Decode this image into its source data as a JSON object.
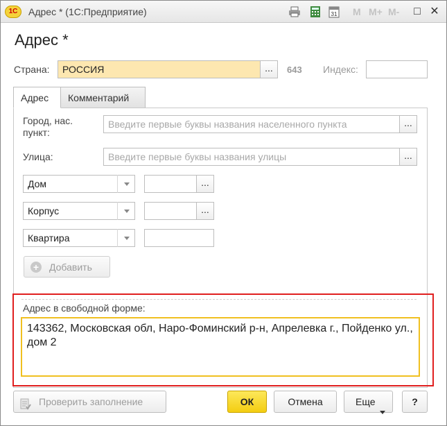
{
  "window": {
    "title": "Адрес * (1С:Предприятие)",
    "logo_text": "1С",
    "m_buttons": [
      "M",
      "M+",
      "M-"
    ],
    "minimize": "□",
    "close": "✕"
  },
  "form": {
    "title": "Адрес *"
  },
  "country": {
    "label": "Страна:",
    "value": "РОССИЯ",
    "code": "643",
    "index_label": "Индекс:",
    "index_value": "",
    "select_label": "..."
  },
  "tabs": [
    {
      "label": "Адрес",
      "active": true
    },
    {
      "label": "Комментарий",
      "active": false
    }
  ],
  "address": {
    "city_label_line1": "Город, нас.",
    "city_label_line2": "пункт:",
    "city_placeholder": "Введите первые буквы названия населенного пункта",
    "street_label": "Улица:",
    "street_placeholder": "Введите первые буквы названия улицы",
    "ellipsis": "...",
    "rows": [
      {
        "type": "Дом",
        "value": ""
      },
      {
        "type": "Корпус",
        "value": ""
      },
      {
        "type": "Квартира",
        "value": ""
      }
    ],
    "add_button": "Добавить"
  },
  "free_form": {
    "label": "Адрес в свободной форме:",
    "value": "143362, Московская обл, Наро-Фоминский р-н, Апрелевка г., Пойденко ул., дом 2"
  },
  "footer": {
    "check_button": "Проверить заполнение",
    "ok_button": "ОК",
    "cancel_button": "Отмена",
    "more_button": "Еще",
    "help_button": "?"
  },
  "colors": {
    "accent_yellow": "#f3cd11",
    "highlight_field": "#fde7b0",
    "red_frame": "#e01e1e"
  }
}
